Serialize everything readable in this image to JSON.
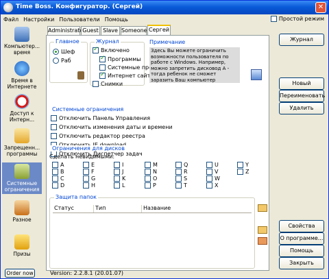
{
  "title": "Time Boss. Конфигуратор. (Сергей)",
  "menu": [
    "Файл",
    "Настройки",
    "Пользователи",
    "Помощь"
  ],
  "simple_mode": "Простой режим",
  "sidebar": [
    {
      "label": "Компьютер... время",
      "icon": "computer-icon"
    },
    {
      "label": "Время в Интернете",
      "icon": "internet-icon"
    },
    {
      "label": "Доступ к Интерн...",
      "icon": "no-access-icon"
    },
    {
      "label": "Запрещенн... программы",
      "icon": "programs-icon"
    },
    {
      "label": "Системные ограничения",
      "icon": "system-icon"
    },
    {
      "label": "Разное",
      "icon": "misc-icon"
    },
    {
      "label": "Призы",
      "icon": "gift-icon"
    }
  ],
  "tabs": [
    "Administrator",
    "Guest",
    "Slave",
    "Someone",
    "Сергей"
  ],
  "main_group": {
    "title": "Главное",
    "options": [
      "Шеф",
      "Раб"
    ]
  },
  "log_group": {
    "title": "Журнал",
    "items": [
      "Включено",
      "Программы",
      "Системные прог",
      "Интернет сайты",
      "Снимки"
    ]
  },
  "note_group": {
    "title": "Примечание",
    "text": "Здесь Вы можете ограничить возможности пользователя по работе с Windows. Например, можно запретить дисковод А - тогда ребенок не сможет заразить Ваш компьютер вирусами прочитав дискетту"
  },
  "sysrestrict": {
    "title": "Системные ограничения",
    "items": [
      "Отключить Панель Управления",
      "Отключить изменения даты и времени",
      "Отключить редактор реестра",
      "Отключить IE download",
      "Отключить Диспетчер задач"
    ]
  },
  "disks": {
    "title": "Ограничения для дисков",
    "label": "Сделать невидимыми:",
    "letters": [
      "A",
      "B",
      "C",
      "D",
      "E",
      "F",
      "G",
      "H",
      "I",
      "J",
      "K",
      "L",
      "M",
      "N",
      "O",
      "P",
      "Q",
      "R",
      "S",
      "T",
      "U",
      "V",
      "W",
      "X",
      "Y",
      "Z"
    ]
  },
  "folders": {
    "title": "Защита папок",
    "cols": [
      "Статус",
      "Тип",
      "Название"
    ]
  },
  "buttons": {
    "journal": "Журнал",
    "new": "Новый",
    "rename": "Переименовать",
    "delete": "Удалить",
    "props": "Свойства",
    "about": "О программе...",
    "help": "Помощь",
    "close": "Закрыть"
  },
  "status": {
    "order": "Order now",
    "version": "Version: 2.2.8.1 (20.01.07)"
  }
}
